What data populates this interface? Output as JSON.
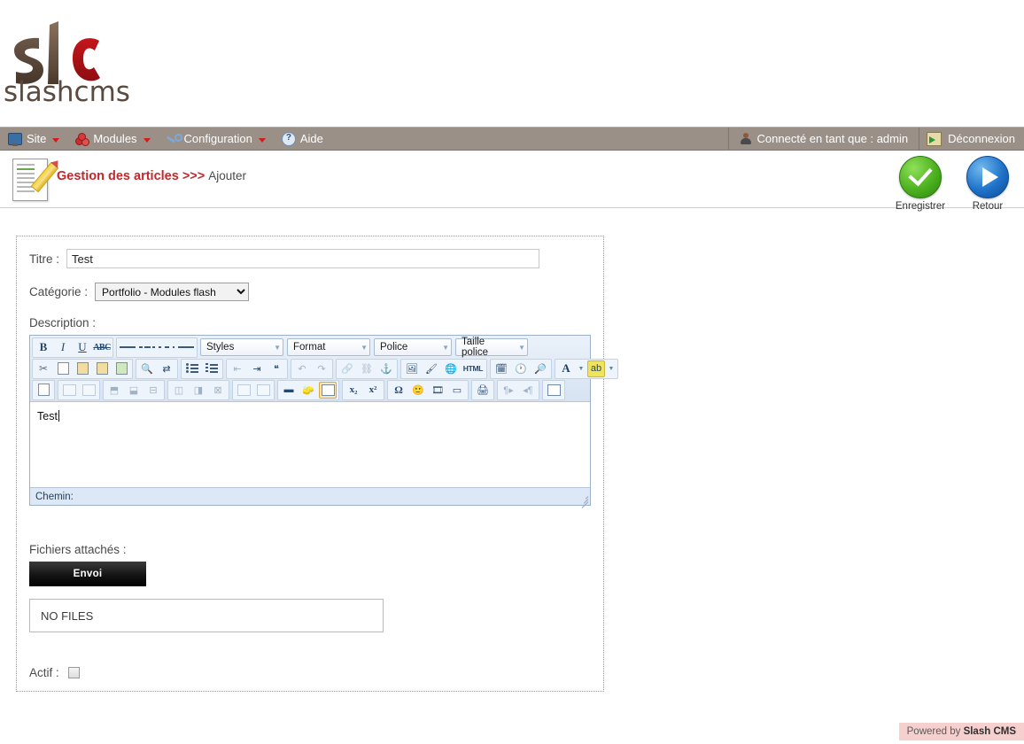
{
  "logo": {
    "mark": "slc",
    "wordmark": "slashcms"
  },
  "menubar": {
    "items": [
      {
        "label": "Site",
        "icon": "monitor-icon",
        "has_caret": true
      },
      {
        "label": "Modules",
        "icon": "modules-icon",
        "has_caret": true
      },
      {
        "label": "Configuration",
        "icon": "wrench-icon",
        "has_caret": true
      },
      {
        "label": "Aide",
        "icon": "help-icon",
        "has_caret": false
      }
    ],
    "user_status": "Connecté en tant que : admin",
    "logout_label": "Déconnexion"
  },
  "page_header": {
    "title_main": "Gestion des articles >>>",
    "title_sub": "Ajouter",
    "icon": "article-edit-icon",
    "actions": [
      {
        "label": "Enregistrer",
        "icon": "green-check-icon"
      },
      {
        "label": "Retour",
        "icon": "blue-play-icon"
      }
    ]
  },
  "form": {
    "title_label": "Titre :",
    "title_value": "Test",
    "category_label": "Catégorie :",
    "category_value": "Portfolio - Modules flash",
    "category_options": [
      "Portfolio - Modules flash"
    ],
    "description_label": "Description :",
    "files_label": "Fichiers attachés :",
    "upload_button": "Envoi",
    "files_status": "NO FILES",
    "active_label": "Actif :",
    "active_checked": false
  },
  "editor": {
    "content": "Test",
    "status_label": "Chemin:",
    "combos": [
      {
        "name": "styles",
        "label": "Styles"
      },
      {
        "name": "format",
        "label": "Format"
      },
      {
        "name": "police",
        "label": "Police"
      },
      {
        "name": "taille",
        "label": "Taille police"
      }
    ],
    "row1_buttons": [
      "bold",
      "italic",
      "underline",
      "strikethrough",
      "align-left",
      "align-center",
      "align-right",
      "align-justify"
    ],
    "row2_buttons": [
      "cut",
      "copy",
      "paste",
      "paste-text",
      "paste-word",
      "find",
      "replace",
      "bulleted-list",
      "numbered-list",
      "outdent",
      "indent",
      "blockquote",
      "undo",
      "redo",
      "link",
      "unlink",
      "anchor",
      "image",
      "brush",
      "about",
      "source",
      "template",
      "time",
      "preview",
      "text-color",
      "background-color"
    ],
    "row3_buttons": [
      "form",
      "table-cell",
      "table-cell-merge",
      "row-insert-before",
      "row-insert-after",
      "row-delete",
      "column-insert-before",
      "column-insert-after",
      "column-delete",
      "table-properties",
      "cell-properties",
      "horizontal-rule",
      "remove-format",
      "table",
      "subscript",
      "superscript",
      "special-char",
      "smiley",
      "flash",
      "page-break",
      "print",
      "ltr",
      "rtl",
      "show-blocks"
    ],
    "source_label": "HTML"
  },
  "footer": {
    "powered_prefix": "Powered by",
    "powered_brand": "Slash CMS"
  },
  "colors": {
    "menubar": "#9a9087",
    "title_red": "#c0282d",
    "accent_caret": "#d61a1a",
    "footer_bg": "#f6cfcf",
    "save_green": "#4cb11e",
    "back_blue": "#1e72c8"
  }
}
